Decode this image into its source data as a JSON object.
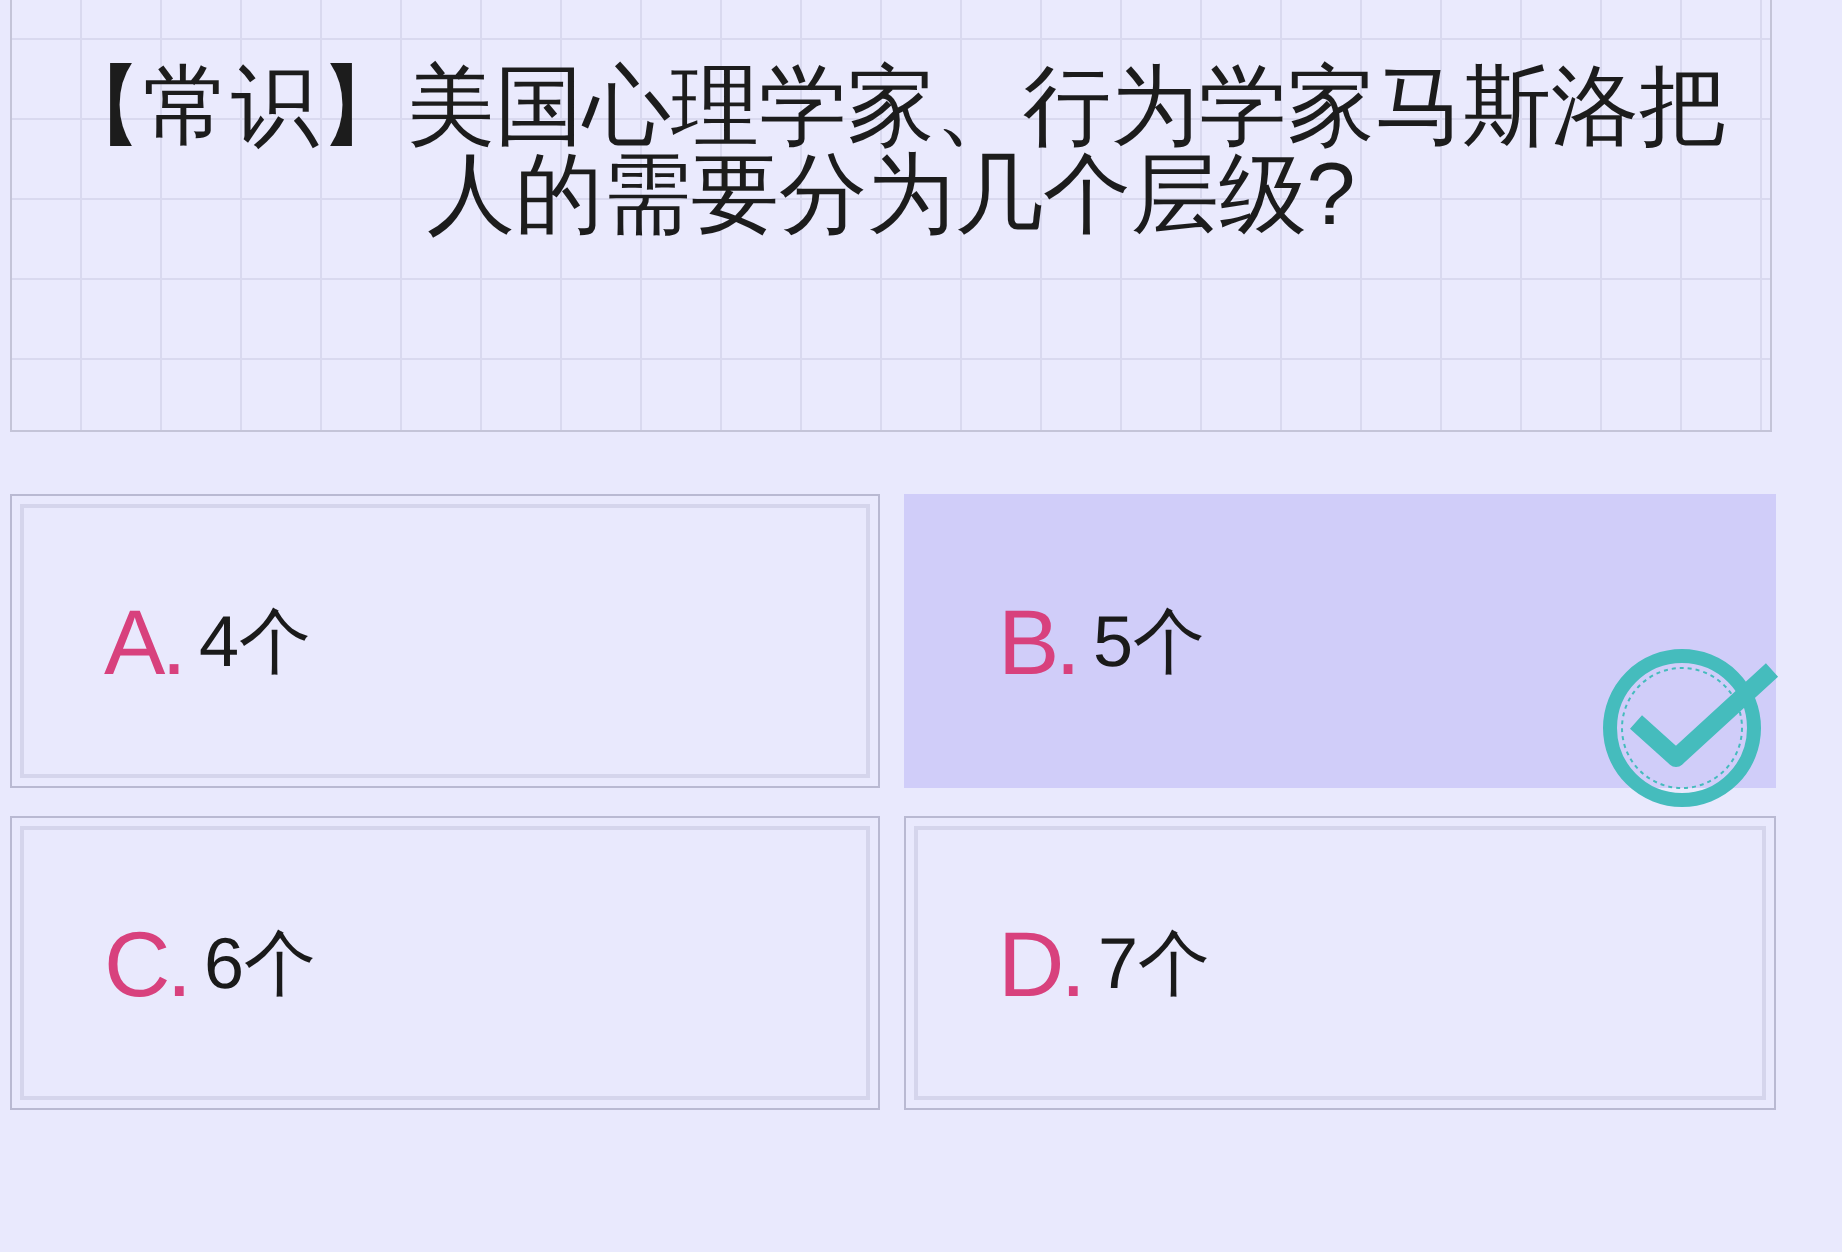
{
  "question": {
    "text": "【常识】美国心理学家、行为学家马斯洛把人的需要分为几个层级?"
  },
  "options": [
    {
      "letter": "A.",
      "text": "4个",
      "selected": false
    },
    {
      "letter": "B.",
      "text": "5个",
      "selected": true
    },
    {
      "letter": "C.",
      "text": "6个",
      "selected": false
    },
    {
      "letter": "D.",
      "text": "7个",
      "selected": false
    }
  ]
}
